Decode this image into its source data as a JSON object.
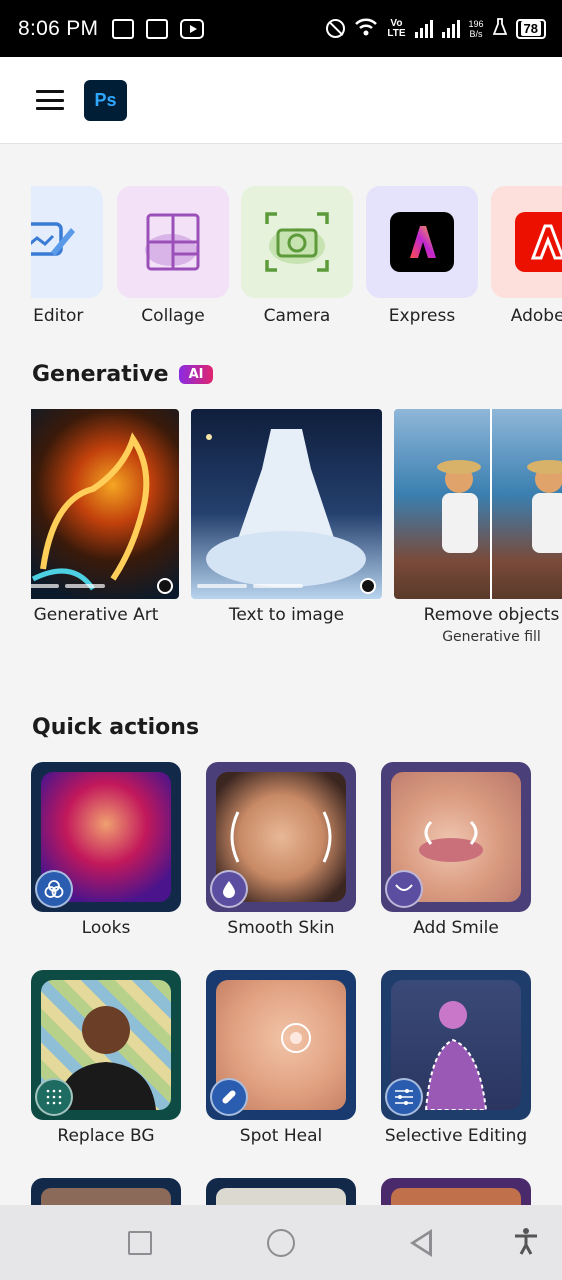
{
  "status_bar": {
    "time": "8:06 PM",
    "network_speed_top": "196",
    "network_speed_bottom": "B/s",
    "lte_top": "Vo",
    "lte_bottom": "LTE",
    "battery": "78"
  },
  "header": {
    "logo_text": "Ps"
  },
  "tools": [
    {
      "label": "to Editor",
      "icon": "photo-editor-icon",
      "bg": "#e3edfb"
    },
    {
      "label": "Collage",
      "icon": "collage-icon",
      "bg": "#f2e1f7"
    },
    {
      "label": "Camera",
      "icon": "camera-icon",
      "bg": "#e6f2dc"
    },
    {
      "label": "Express",
      "icon": "adobe-express-icon",
      "bg": "#e5e3fb"
    },
    {
      "label": "Adobe Fi",
      "icon": "adobe-firefly-icon",
      "bg": "#fde0dc"
    }
  ],
  "generative": {
    "title": "Generative",
    "badge": "AI",
    "cards": [
      {
        "label": "Generative Art",
        "sub": ""
      },
      {
        "label": "Text to image",
        "sub": ""
      },
      {
        "label": "Remove objects",
        "sub": "Generative fill"
      }
    ]
  },
  "quick_actions": {
    "title": "Quick actions",
    "items": [
      {
        "label": "Looks",
        "icon": "looks-icon",
        "tile_bg": "#13294a"
      },
      {
        "label": "Smooth Skin",
        "icon": "droplet-icon",
        "tile_bg": "#4a3f78"
      },
      {
        "label": "Add Smile",
        "icon": "smile-icon",
        "tile_bg": "#4a3f78"
      },
      {
        "label": "Replace BG",
        "icon": "replace-bg-icon",
        "tile_bg": "#0f4b45"
      },
      {
        "label": "Spot Heal",
        "icon": "bandage-icon",
        "tile_bg": "#183a6e"
      },
      {
        "label": "Selective Editing",
        "icon": "sliders-icon",
        "tile_bg": "#1f3d6b"
      }
    ]
  },
  "colors": {
    "ai_badge_start": "#8a2be2",
    "ai_badge_end": "#e0246c",
    "ps_logo_bg": "#001e36",
    "ps_logo_fg": "#31a8ff"
  }
}
